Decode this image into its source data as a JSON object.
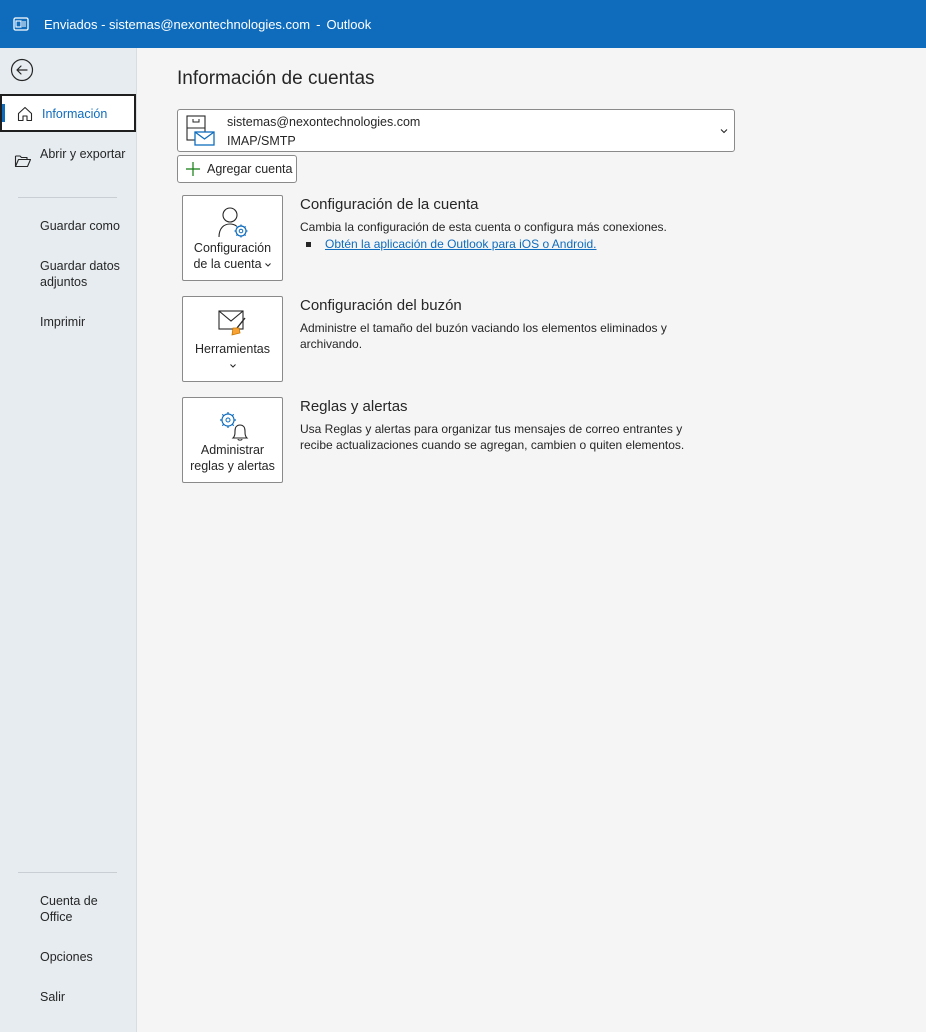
{
  "window": {
    "title": "Enviados - sistemas@nexontechnologies.com",
    "separator": "-",
    "app": "Outlook",
    "accent": "#0f6cbd"
  },
  "sidebar": {
    "back_icon": "back-arrow-icon",
    "items": [
      {
        "label": "Información",
        "icon": "home-icon",
        "active": true
      },
      {
        "label": "Abrir y exportar",
        "icon": "folder-open-icon"
      },
      {
        "label": "Guardar como"
      },
      {
        "label": "Guardar datos adjuntos"
      },
      {
        "label": "Imprimir"
      }
    ],
    "bottom_items": [
      {
        "label": "Cuenta de Office"
      },
      {
        "label": "Opciones"
      },
      {
        "label": "Salir"
      }
    ]
  },
  "main": {
    "page_title": "Información de cuentas",
    "account": {
      "email": "sistemas@nexontechnologies.com",
      "type": "IMAP/SMTP"
    },
    "add_account_label": "Agregar cuenta",
    "sections": [
      {
        "tile_label_line1": "Configuración",
        "tile_label_line2": "de la cuenta",
        "title": "Configuración de la cuenta",
        "description": "Cambia la configuración de esta cuenta o configura más conexiones.",
        "link": "Obtén la aplicación de Outlook para iOS o Android."
      },
      {
        "tile_label_line1": "Herramientas",
        "title": "Configuración del buzón",
        "description": "Administre el tamaño del buzón vaciando los elementos eliminados y archivando."
      },
      {
        "tile_label_line1": "Administrar",
        "tile_label_line2": "reglas y alertas",
        "title": "Reglas y alertas",
        "description": "Usa Reglas y alertas para organizar tus mensajes de correo entrantes y recibe actualizaciones cuando se agregan, cambien o quiten elementos."
      }
    ]
  }
}
